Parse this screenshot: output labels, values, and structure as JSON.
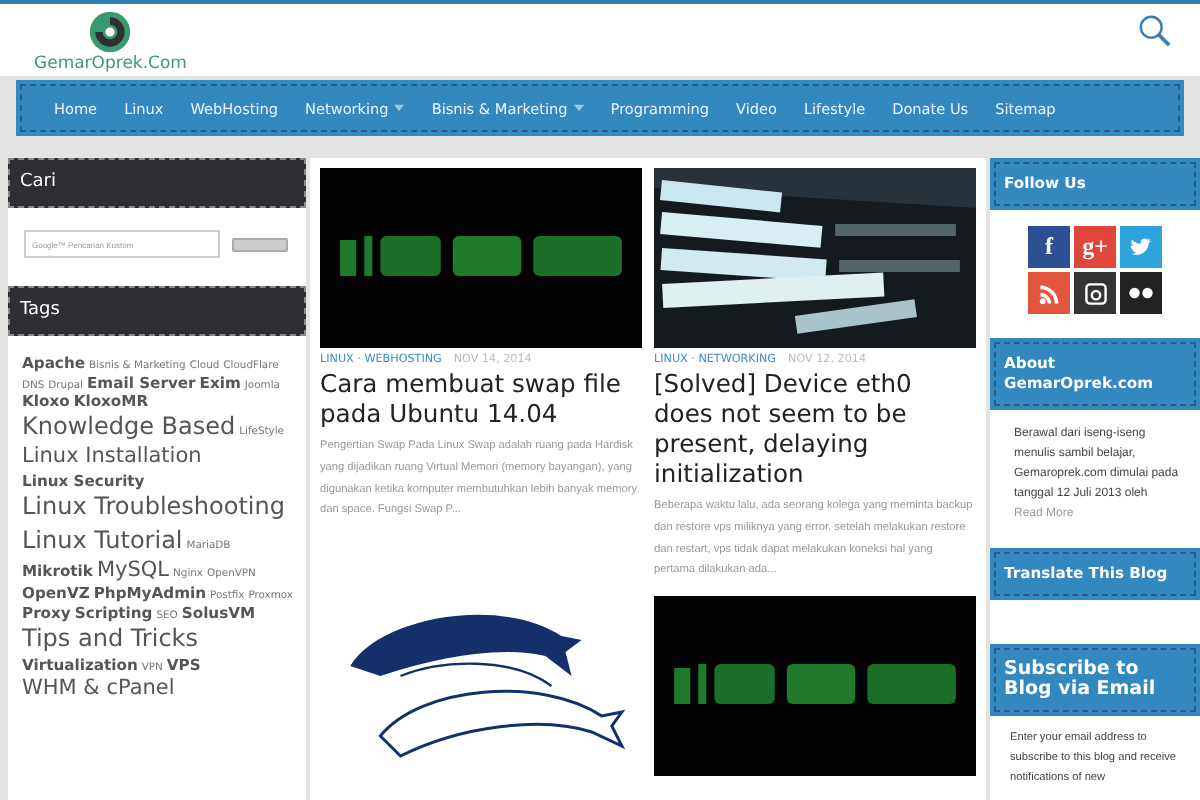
{
  "site": {
    "name": "GemarOprek.Com"
  },
  "nav": [
    {
      "label": "Home",
      "has_menu": false
    },
    {
      "label": "Linux",
      "has_menu": false
    },
    {
      "label": "WebHosting",
      "has_menu": false
    },
    {
      "label": "Networking",
      "has_menu": true
    },
    {
      "label": "Bisnis & Marketing",
      "has_menu": true
    },
    {
      "label": "Programming",
      "has_menu": false
    },
    {
      "label": "Video",
      "has_menu": false
    },
    {
      "label": "Lifestyle",
      "has_menu": false
    },
    {
      "label": "Donate Us",
      "has_menu": false
    },
    {
      "label": "Sitemap",
      "has_menu": false
    }
  ],
  "left_sidebar": {
    "search_title": "Cari",
    "search": {
      "placeholder": "Google™ Pencarian Kustom"
    },
    "tags_title": "Tags",
    "tags": [
      {
        "label": "Apache",
        "kind": "medium"
      },
      {
        "label": "Bisnis & Marketing",
        "kind": "small"
      },
      {
        "label": "Cloud",
        "kind": "small"
      },
      {
        "label": "CloudFlare",
        "kind": "small"
      },
      {
        "label": "DNS",
        "kind": "small"
      },
      {
        "label": "Drupal",
        "kind": "small"
      },
      {
        "label": "Email Server",
        "kind": "medium"
      },
      {
        "label": "Exim",
        "kind": "medium"
      },
      {
        "label": "Joomla",
        "kind": "small"
      },
      {
        "label": "Kloxo",
        "kind": "medium"
      },
      {
        "label": "KloxoMR",
        "kind": "medium"
      },
      {
        "label": "Knowledge Based",
        "kind": "huge"
      },
      {
        "label": "LifeStyle",
        "kind": "small"
      },
      {
        "label": "Linux Installation",
        "kind": "large"
      },
      {
        "label": "Linux Security",
        "kind": "medium"
      },
      {
        "label": "Linux Troubleshooting",
        "kind": "huge"
      },
      {
        "label": "Linux Tutorial",
        "kind": "huge"
      },
      {
        "label": "MariaDB",
        "kind": "small"
      },
      {
        "label": "Mikrotik",
        "kind": "medium"
      },
      {
        "label": "MySQL",
        "kind": "large"
      },
      {
        "label": "Nginx",
        "kind": "small"
      },
      {
        "label": "OpenVPN",
        "kind": "small"
      },
      {
        "label": "OpenVZ",
        "kind": "medium"
      },
      {
        "label": "PhpMyAdmin",
        "kind": "medium"
      },
      {
        "label": "Postfix",
        "kind": "small"
      },
      {
        "label": "Proxmox",
        "kind": "small"
      },
      {
        "label": "Proxy",
        "kind": "medium"
      },
      {
        "label": "Scripting",
        "kind": "medium"
      },
      {
        "label": "SEO",
        "kind": "small"
      },
      {
        "label": "SolusVM",
        "kind": "medium"
      },
      {
        "label": "Tips and Tricks",
        "kind": "huge"
      },
      {
        "label": "Virtualization",
        "kind": "medium"
      },
      {
        "label": "VPN",
        "kind": "small"
      },
      {
        "label": "VPS",
        "kind": "medium"
      },
      {
        "label": "WHM & cPanel",
        "kind": "large"
      }
    ]
  },
  "posts": [
    {
      "kind": "picture",
      "categories": "LINUX · WEBHOSTING",
      "date": "NOV 14, 2014",
      "title": "Cara membuat swap file pada Ubuntu 14.04",
      "excerpt": "Pengertian Swap Pada Linux Swap adalah ruang pada Hardisk yang dijadikan ruang Virtual Memori (memory bayangan), yang digunakan ketika komputer membutuhkan lebih banyak memory dan space. Fungsi Swap P..."
    },
    {
      "kind": "picture",
      "categories": "LINUX · NETWORKING",
      "date": "NOV 12, 2014",
      "title": "[Solved] Device eth0 does not seem to be present, delaying initialization",
      "excerpt": "Beberapa waktu lalu, ada seorang kolega yang meminta backup dan restore vps miliknya yang error. setelah melakukan restore dan restart, vps tidak dapat melakukan koneksi hal yang pertama dilakukan ada..."
    },
    {
      "kind": "picture"
    },
    {
      "kind": "picture"
    }
  ],
  "right_sidebar": {
    "follow_title": "Follow Us",
    "social": [
      {
        "kind": "facebook",
        "glyph": "f",
        "color": "#2d4f93"
      },
      {
        "kind": "googleplus",
        "glyph": "g+",
        "color": "#e0463a"
      },
      {
        "kind": "twitter",
        "color": "#2fa3dc"
      },
      {
        "kind": "rss",
        "color": "#e2553e"
      },
      {
        "kind": "instagram",
        "color": "#333333"
      },
      {
        "kind": "flickr",
        "color": "#222222"
      }
    ],
    "about_title": "About GemarOprek.com",
    "about_text": "Berawal dari iseng-iseng menulis sambil belajar, Gemaroprek.com dimulai pada tanggal 12 Juli 2013 oleh",
    "about_link": "Read More",
    "translate_title": "Translate This Blog",
    "subscribe_title": "Subscribe to Blog via Email",
    "subscribe_text": "Enter your email address to subscribe to this blog and receive notifications of new"
  }
}
